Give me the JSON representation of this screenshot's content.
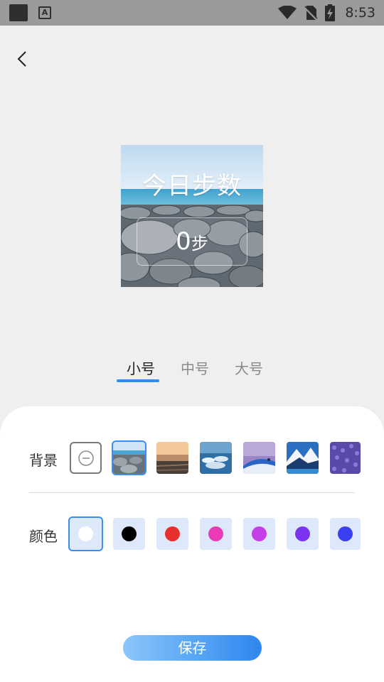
{
  "status_bar": {
    "time": "8:53",
    "icons": [
      "app-square-icon",
      "keyboard-a-icon",
      "wifi-icon",
      "no-sim-icon",
      "battery-charging-icon"
    ]
  },
  "header": {
    "back_icon": "chevron-left-icon"
  },
  "preview": {
    "title": "今日步数",
    "steps_value": "0",
    "steps_unit": "步"
  },
  "size_tabs": [
    {
      "label": "小号",
      "active": true
    },
    {
      "label": "中号",
      "active": false
    },
    {
      "label": "大号",
      "active": false
    }
  ],
  "settings": {
    "background_label": "背景",
    "color_label": "颜色",
    "backgrounds": [
      "none",
      "pebble-beach",
      "sunset-sea",
      "blue-sea",
      "purple-snow-hill",
      "snow-mountain-lake",
      "lavender-field"
    ],
    "selected_background": "pebble-beach",
    "colors": [
      "#ffffff",
      "#000000",
      "#e8312e",
      "#e83bb6",
      "#c63fe6",
      "#7a33ef",
      "#3a3ff0"
    ],
    "selected_color": "#ffffff"
  },
  "save_label": "保存",
  "accent_color": "#2f8cf0"
}
